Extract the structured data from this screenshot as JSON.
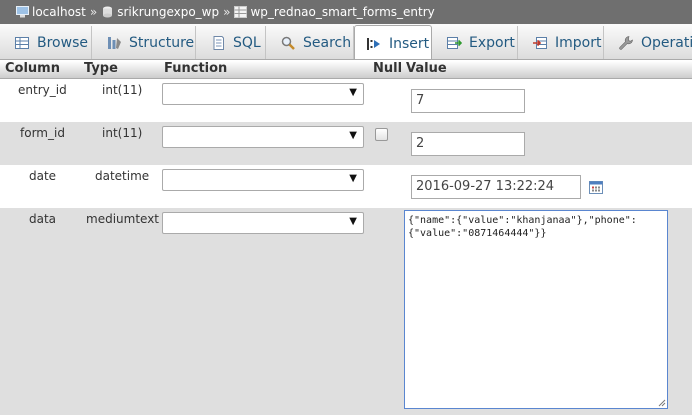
{
  "breadcrumb": {
    "server": "localhost",
    "database": "srikrungexpo_wp",
    "table": "wp_rednao_smart_forms_entry",
    "separator": "»"
  },
  "tabs": [
    {
      "label": "Browse",
      "icon": "browse-icon"
    },
    {
      "label": "Structure",
      "icon": "structure-icon"
    },
    {
      "label": "SQL",
      "icon": "sql-icon"
    },
    {
      "label": "Search",
      "icon": "search-icon"
    },
    {
      "label": "Insert",
      "icon": "insert-icon",
      "active": true
    },
    {
      "label": "Export",
      "icon": "export-icon"
    },
    {
      "label": "Import",
      "icon": "import-icon"
    },
    {
      "label": "Operation",
      "icon": "wrench-icon"
    }
  ],
  "columns": {
    "column": "Column",
    "type": "Type",
    "function": "Function",
    "null": "Null",
    "value": "Value"
  },
  "rows": [
    {
      "column": "entry_id",
      "type": "int(11)",
      "function": "",
      "null": false,
      "value": "7"
    },
    {
      "column": "form_id",
      "type": "int(11)",
      "function": "",
      "null": false,
      "value": "2"
    },
    {
      "column": "date",
      "type": "datetime",
      "function": "",
      "null": false,
      "value": "2016-09-27 13:22:24"
    },
    {
      "column": "data",
      "type": "mediumtext",
      "function": "",
      "null": false,
      "value": "{\"name\":{\"value\":\"khanjanaa\"},\"phone\":\n{\"value\":\"0871464444\"}}"
    }
  ],
  "colors": {
    "link": "#235a81",
    "breadcrumb_bg": "#6f6f6f",
    "row_even": "#dfdfdf",
    "textarea_focus": "#5a86d0"
  }
}
